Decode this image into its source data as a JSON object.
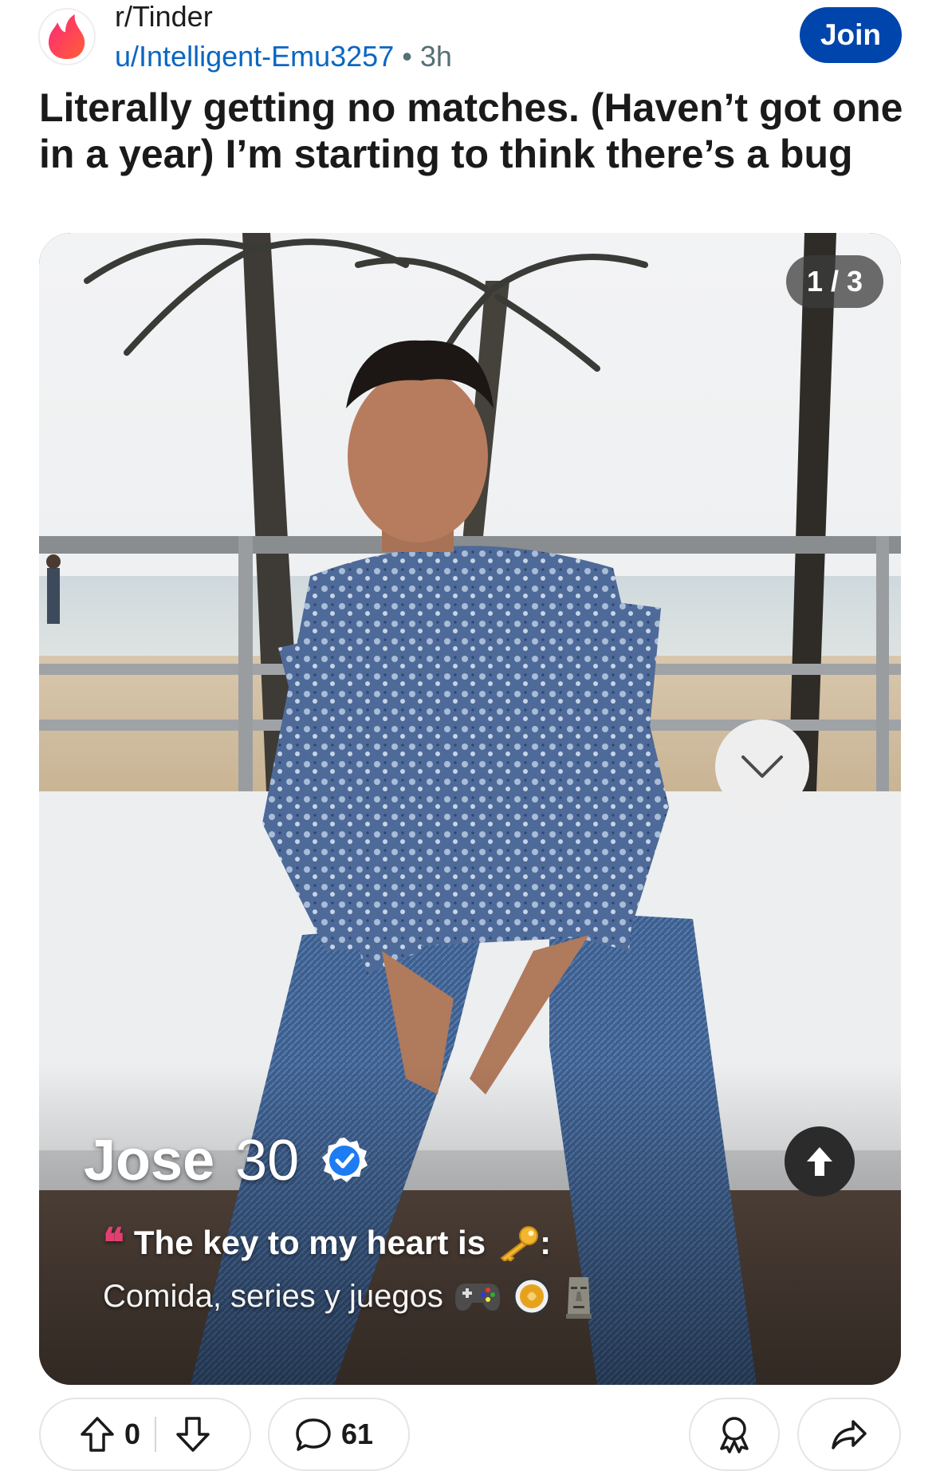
{
  "header": {
    "subreddit": "r/Tinder",
    "username": "u/Intelligent-Emu3257",
    "separator": "•",
    "age": "3h",
    "join_label": "Join"
  },
  "post": {
    "title": "Literally getting no matches. (Haven’t got one in a year) I’m starting to think there’s a bug"
  },
  "media": {
    "counter": "1 / 3",
    "profile": {
      "name": "Jose",
      "age": "30",
      "prompt_quote": "❝",
      "prompt": "The key to my heart is",
      "prompt_suffix": ":",
      "answer": "Comida, series y juegos"
    },
    "icons": [
      "chevron-down-icon",
      "arrow-up-icon",
      "verified-badge-icon",
      "key-emoji",
      "gamepad-emoji",
      "coin-emoji",
      "moai-emoji"
    ]
  },
  "actions": {
    "score": "0",
    "comments": "61"
  },
  "colors": {
    "join": "#0045ac",
    "link": "#0a66c2",
    "tinder": "#fe3c72"
  }
}
